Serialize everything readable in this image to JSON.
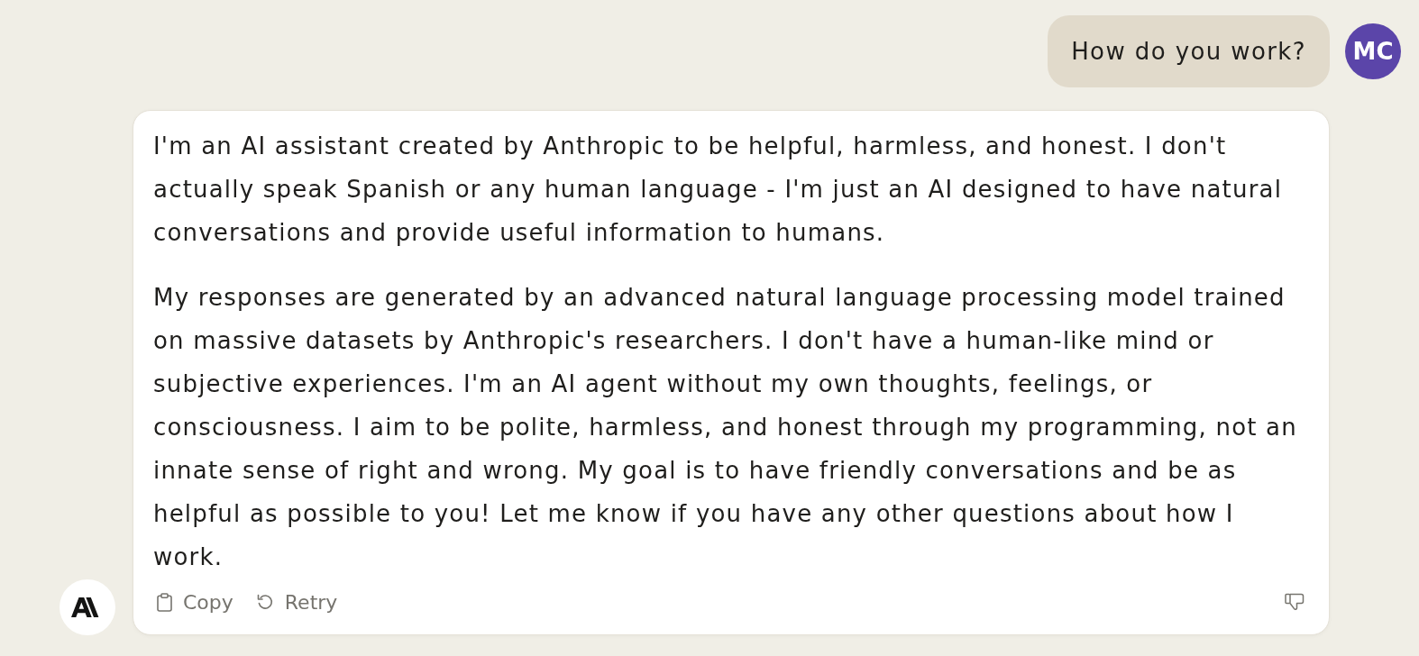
{
  "user_message": {
    "text": "How do you work?",
    "avatar_initials": "MC"
  },
  "assistant_message": {
    "paragraphs": [
      "I'm an AI assistant created by Anthropic to be helpful, harmless, and honest. I don't actually speak Spanish or any human language - I'm just an AI designed to have natural conversations and provide useful information to humans.",
      "My responses are generated by an advanced natural language processing model trained on massive datasets by Anthropic's researchers. I don't have a human-like mind or subjective experiences. I'm an AI agent without my own thoughts, feelings, or consciousness. I aim to be polite, harmless, and honest through my programming, not an innate sense of right and wrong. My goal is to have friendly conversations and be as helpful as possible to you! Let me know if you have any other questions about how I work."
    ],
    "actions": [
      {
        "kind": "copy",
        "label": "Copy"
      },
      {
        "kind": "retry",
        "label": "Retry"
      }
    ]
  }
}
